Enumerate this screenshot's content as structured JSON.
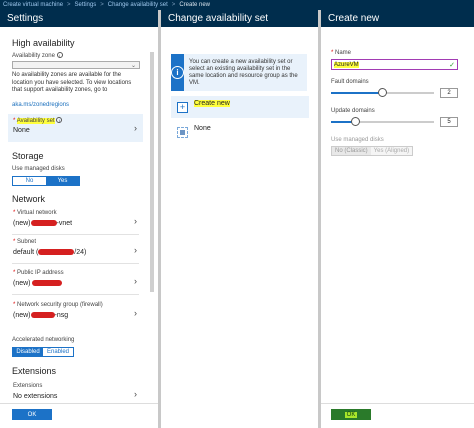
{
  "breadcrumb": {
    "items": [
      "Create virtual machine",
      "Settings",
      "Change availability set"
    ],
    "separator": ">",
    "current": "Create new"
  },
  "settings": {
    "title": "Settings",
    "high_availability": {
      "heading": "High availability",
      "zone_label": "Availability zone",
      "zone_info": "i",
      "zone_value": "",
      "help": "No availability zones are available for the location you have selected. To view locations that support availability zones, go to",
      "help_link": "aka.ms/zonedregions",
      "availability_set_label": "Availability set",
      "availability_set_value": "None"
    },
    "storage": {
      "heading": "Storage",
      "managed_disks_label": "Use managed disks",
      "options": [
        "No",
        "Yes"
      ],
      "selected": "Yes"
    },
    "network": {
      "heading": "Network",
      "vnet_label": "Virtual network",
      "vnet_prefix": "(new)",
      "vnet_suffix": "-vnet",
      "subnet_label": "Subnet",
      "subnet_prefix": "default (",
      "subnet_suffix": "/24)",
      "pip_label": "Public IP address",
      "pip_prefix": "(new)",
      "nsg_label": "Network security group (firewall)",
      "nsg_prefix": "(new)",
      "nsg_suffix": "-nsg",
      "accel_label": "Accelerated networking",
      "accel_options": [
        "Disabled",
        "Enabled"
      ],
      "accel_selected": "Disabled"
    },
    "extensions": {
      "heading": "Extensions",
      "label": "Extensions",
      "value": "No extensions"
    },
    "ok_label": "OK"
  },
  "change_set": {
    "title": "Change availability set",
    "info_text": "You can create a new availability set or select an existing availability set in the same location and resource group as the VM.",
    "items": [
      {
        "label": "Create new"
      },
      {
        "label": "None"
      }
    ]
  },
  "create_new": {
    "title": "Create new",
    "name_label": "Name",
    "name_value": "AzureVM",
    "fault_label": "Fault domains",
    "fault_value": "2",
    "fault_max": 3,
    "update_label": "Update domains",
    "update_value": "5",
    "update_max": 20,
    "managed_label": "Use managed disks",
    "managed_options": [
      "No (Classic)",
      "Yes (Aligned)"
    ],
    "managed_selected": "No (Classic)",
    "ok_label": "OK"
  },
  "colors": {
    "header_bg": "#002d4d",
    "accent": "#1c72c7",
    "highlight": "#ffff3c",
    "ok_green": "#2a7a2a"
  }
}
